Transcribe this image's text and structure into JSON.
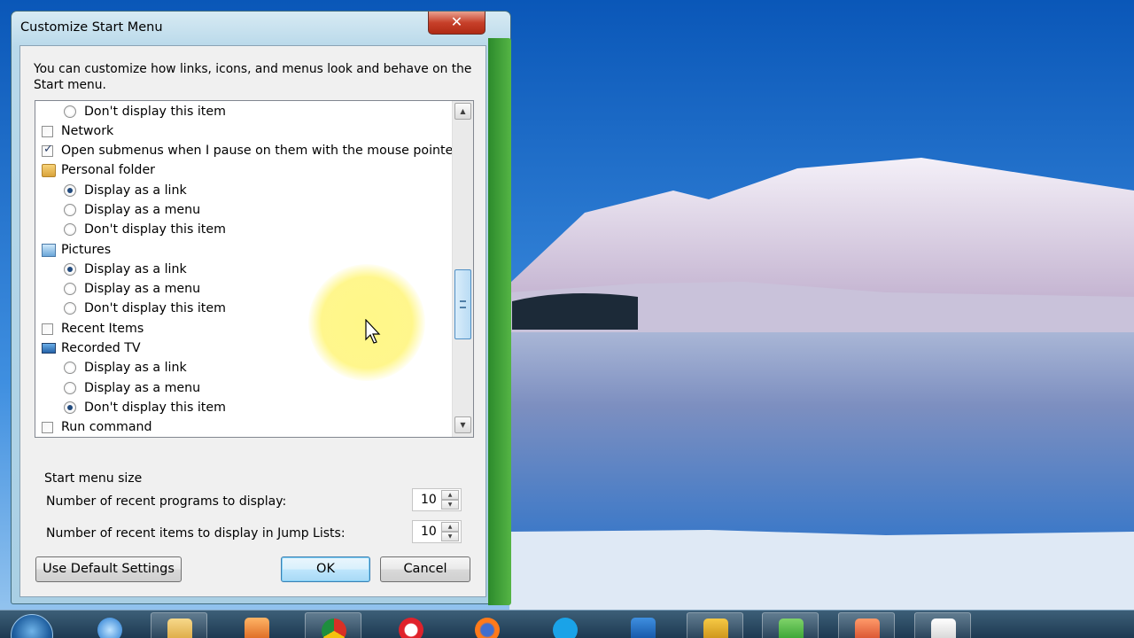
{
  "window": {
    "title": "Customize Start Menu",
    "close_glyph": "✕",
    "description": "You can customize how links, icons, and menus look and behave on the Start menu."
  },
  "tree": {
    "items": [
      {
        "kind": "radio",
        "label": "Don't display this item",
        "checked": false
      },
      {
        "kind": "checkbox",
        "label": "Network",
        "checked": false
      },
      {
        "kind": "checkbox",
        "label": "Open submenus when I pause on them with the mouse pointer",
        "checked": true
      },
      {
        "kind": "group",
        "icon": "folder-icon",
        "label": "Personal folder"
      },
      {
        "kind": "radio",
        "label": "Display as a link",
        "checked": true
      },
      {
        "kind": "radio",
        "label": "Display as a menu",
        "checked": false
      },
      {
        "kind": "radio",
        "label": "Don't display this item",
        "checked": false
      },
      {
        "kind": "group",
        "icon": "pictures-icon",
        "label": "Pictures"
      },
      {
        "kind": "radio",
        "label": "Display as a link",
        "checked": true
      },
      {
        "kind": "radio",
        "label": "Display as a menu",
        "checked": false
      },
      {
        "kind": "radio",
        "label": "Don't display this item",
        "checked": false
      },
      {
        "kind": "checkbox",
        "label": "Recent Items",
        "checked": false
      },
      {
        "kind": "group",
        "icon": "tv-icon",
        "label": "Recorded TV"
      },
      {
        "kind": "radio",
        "label": "Display as a link",
        "checked": false
      },
      {
        "kind": "radio",
        "label": "Display as a menu",
        "checked": false
      },
      {
        "kind": "radio",
        "label": "Don't display this item",
        "checked": true
      },
      {
        "kind": "checkbox",
        "label": "Run command",
        "checked": false
      }
    ],
    "scroll_up_glyph": "▲",
    "scroll_down_glyph": "▼"
  },
  "size": {
    "title": "Start menu size",
    "recent_programs_label": "Number of recent programs to display:",
    "recent_programs_value": "10",
    "jump_list_label": "Number of recent items to display in Jump Lists:",
    "jump_list_value": "10",
    "spin_up_glyph": "▲",
    "spin_down_glyph": "▼"
  },
  "buttons": {
    "defaults": "Use Default Settings",
    "ok": "OK",
    "cancel": "Cancel"
  },
  "taskbar": {
    "apps": [
      "start-orb",
      "internet-explorer-icon",
      "windows-explorer-icon",
      "media-player-icon",
      "chrome-icon",
      "opera-icon",
      "firefox-icon",
      "skype-icon",
      "outlook-icon",
      "app-icon",
      "camtasia-icon",
      "powerpoint-icon",
      "notepad-icon"
    ]
  },
  "colors": {
    "window_frame": "#b9d9ea",
    "close_button": "#c7402a",
    "default_button": "#bee6fd",
    "cursor_highlight": "#fff782"
  }
}
